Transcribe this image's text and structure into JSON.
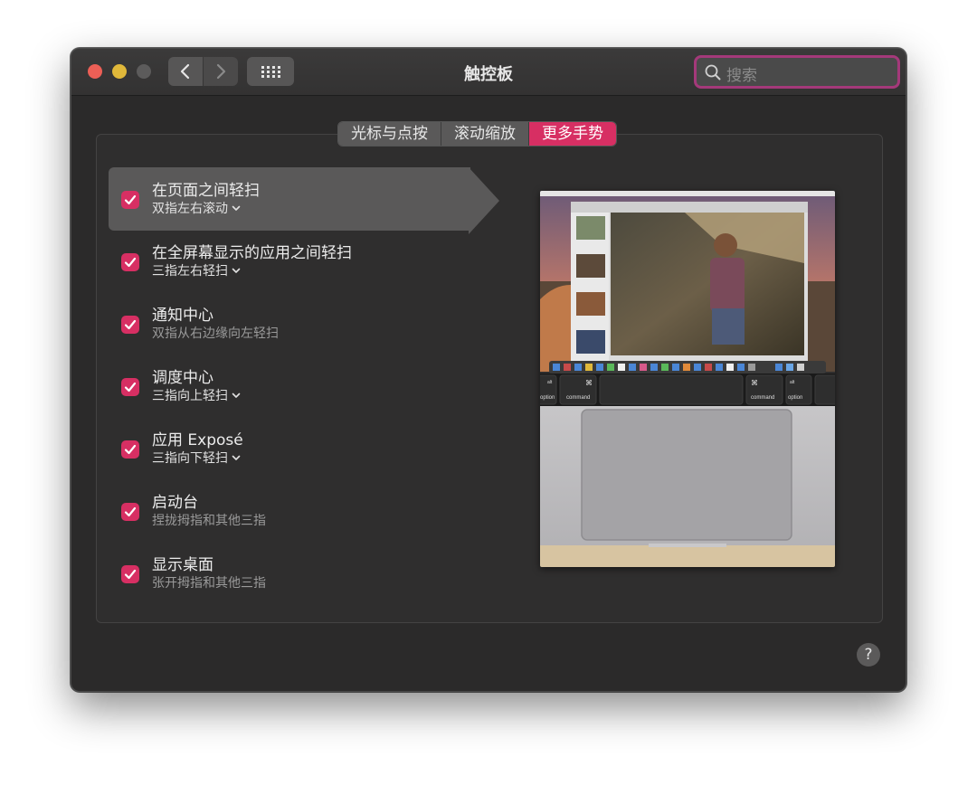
{
  "window": {
    "title": "触控板",
    "traffic_lights": {
      "close": "#ec5f56",
      "minimize": "#e0b83a",
      "zoom": "#5c5b5b"
    }
  },
  "toolbar": {
    "back_icon": "chevron-left-icon",
    "forward_icon": "chevron-right-icon",
    "grid_icon": "grid-icon"
  },
  "search": {
    "placeholder": "搜索",
    "value": ""
  },
  "tabs": [
    {
      "label": "光标与点按",
      "active": false
    },
    {
      "label": "滚动缩放",
      "active": false
    },
    {
      "label": "更多手势",
      "active": true
    }
  ],
  "gestures": [
    {
      "title": "在页面之间轻扫",
      "subtitle": "双指左右滚动",
      "checked": true,
      "has_menu": true,
      "selected": true
    },
    {
      "title": "在全屏幕显示的应用之间轻扫",
      "subtitle": "三指左右轻扫",
      "checked": true,
      "has_menu": true,
      "selected": false
    },
    {
      "title": "通知中心",
      "subtitle": "双指从右边缘向左轻扫",
      "checked": true,
      "has_menu": false,
      "selected": false
    },
    {
      "title": "调度中心",
      "subtitle": "三指向上轻扫",
      "checked": true,
      "has_menu": true,
      "selected": false
    },
    {
      "title": "应用 Exposé",
      "subtitle": "三指向下轻扫",
      "checked": true,
      "has_menu": true,
      "selected": false
    },
    {
      "title": "启动台",
      "subtitle": "捏拢拇指和其他三指",
      "checked": true,
      "has_menu": false,
      "selected": false
    },
    {
      "title": "显示桌面",
      "subtitle": "张开拇指和其他三指",
      "checked": true,
      "has_menu": false,
      "selected": false
    }
  ],
  "preview": {
    "keys": {
      "opt_left": "option",
      "cmd_left": "command",
      "cmd_right": "command",
      "opt_right": "option",
      "cmd_symbol": "⌘",
      "alt": "alt"
    }
  },
  "help": {
    "label": "?"
  },
  "colors": {
    "accent": "#d72f63",
    "search_focus": "#a4397a",
    "window_bg": "#2b2a2a"
  }
}
